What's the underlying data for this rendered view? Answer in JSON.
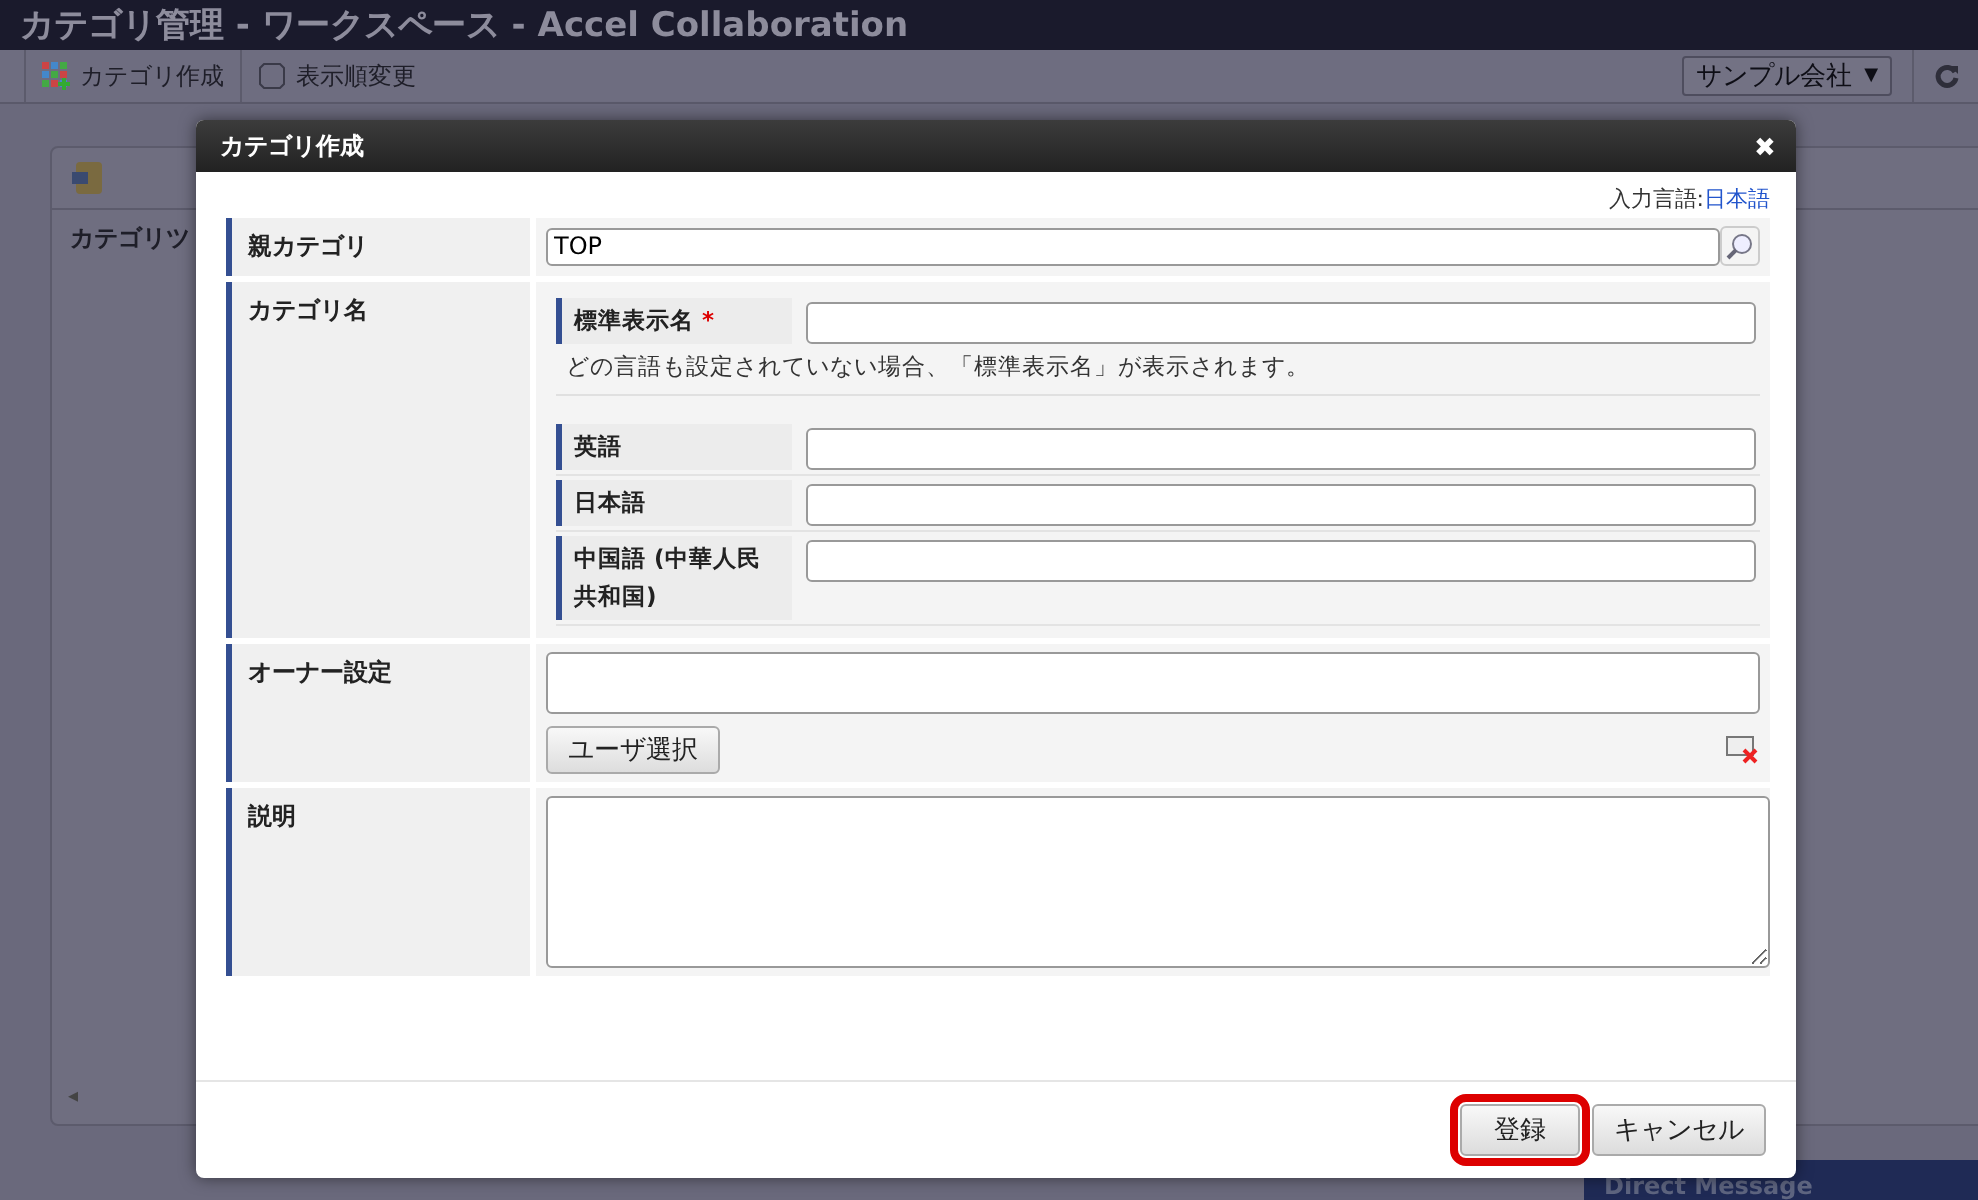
{
  "window": {
    "title": "カテゴリ管理 - ワークスペース - Accel Collaboration"
  },
  "toolbar": {
    "buttons": [
      {
        "label": "カテゴリ作成",
        "kind": "create"
      },
      {
        "label": "表示順変更",
        "kind": "order"
      }
    ],
    "company_select": {
      "value": "サンプル会社",
      "caret": "▼"
    }
  },
  "panel": {
    "heading": "カテゴリツ",
    "scroll_arrow": "◂"
  },
  "footer_bar": {
    "label": "Direct Message"
  },
  "dialog": {
    "title": "カテゴリ作成",
    "close": "✖",
    "input_language": {
      "label": "入力言語:",
      "value": "日本語"
    },
    "fields": [
      {
        "kind": "parent",
        "label": "親カテゴリ",
        "value": "TOP"
      },
      {
        "kind": "names",
        "label": "カテゴリ名",
        "default": {
          "label": "標準表示名",
          "required_mark": "*"
        },
        "note": "どの言語も設定されていない場合、「標準表示名」が表示されます。",
        "languages": [
          {
            "label": "英語"
          },
          {
            "label": "日本語"
          },
          {
            "label": "中国語 (中華人民共和国)"
          }
        ]
      },
      {
        "kind": "owner",
        "label": "オーナー設定",
        "button": "ユーザ選択"
      },
      {
        "kind": "description",
        "label": "説明"
      }
    ],
    "buttons": [
      {
        "label": "登録",
        "highlighted": true
      },
      {
        "label": "キャンセル",
        "highlighted": false
      }
    ]
  }
}
